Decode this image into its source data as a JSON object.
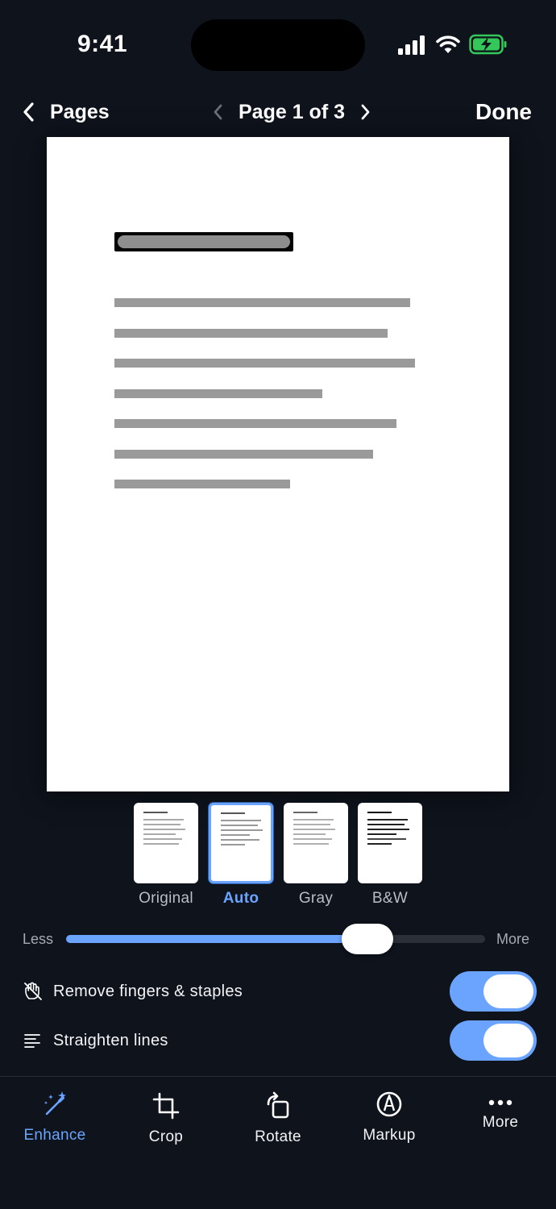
{
  "status_bar": {
    "time": "9:41"
  },
  "nav": {
    "back_label": "Pages",
    "page_indicator": "Page 1 of 3",
    "done_label": "Done"
  },
  "document": {
    "text_line_fractions": [
      0.64,
      0.59,
      0.65,
      0.45,
      0.61,
      0.56,
      0.38
    ]
  },
  "filters": [
    {
      "label": "Original",
      "selected": false
    },
    {
      "label": "Auto",
      "selected": true
    },
    {
      "label": "Gray",
      "selected": false
    },
    {
      "label": "B&W",
      "selected": false
    }
  ],
  "intensity": {
    "less_label": "Less",
    "more_label": "More",
    "value_fraction": 0.72
  },
  "options": [
    {
      "label": "Remove fingers & staples",
      "icon": "hand-slash-icon",
      "enabled": true
    },
    {
      "label": "Straighten lines",
      "icon": "lines-align-icon",
      "enabled": true
    }
  ],
  "toolbar": {
    "items": [
      {
        "label": "Enhance",
        "icon": "magic-wand-icon",
        "active": true
      },
      {
        "label": "Crop",
        "icon": "crop-icon",
        "active": false
      },
      {
        "label": "Rotate",
        "icon": "rotate-icon",
        "active": false
      },
      {
        "label": "Markup",
        "icon": "markup-pen-icon",
        "active": false
      },
      {
        "label": "More",
        "icon": "more-dots-icon",
        "active": false
      }
    ]
  },
  "colors": {
    "accent": "#6ba4ff",
    "background": "#0e131c",
    "battery": "#34c759"
  }
}
